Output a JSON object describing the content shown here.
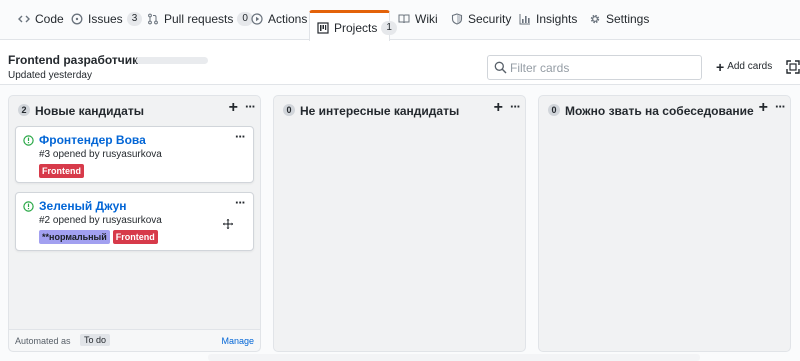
{
  "tabs": [
    {
      "label": "Code",
      "icon": "code-icon",
      "counter": null
    },
    {
      "label": "Issues",
      "icon": "issue-opened-icon",
      "counter": "3"
    },
    {
      "label": "Pull requests",
      "icon": "git-pull-request-icon",
      "counter": "0"
    },
    {
      "label": "Actions",
      "icon": "play-icon",
      "counter": null
    },
    {
      "label": "Projects",
      "icon": "project-icon",
      "counter": "1",
      "selected": true
    },
    {
      "label": "Wiki",
      "icon": "book-icon",
      "counter": null
    },
    {
      "label": "Security",
      "icon": "shield-icon",
      "counter": null
    },
    {
      "label": "Insights",
      "icon": "graph-icon",
      "counter": null
    },
    {
      "label": "Settings",
      "icon": "gear-icon",
      "counter": null
    }
  ],
  "project": {
    "title": "Frontend разработчики",
    "updated": "Updated yesterday"
  },
  "toolbar": {
    "filter_placeholder": "Filter cards",
    "filter_value": "",
    "add_cards_label": "Add cards"
  },
  "columns": [
    {
      "count": "2",
      "name": "Новые кандидаты",
      "footer": {
        "automated_as": "Automated as",
        "badge": "To do",
        "manage": "Manage"
      },
      "cards": [
        {
          "title": "Фронтендер Вова",
          "meta": "#3 opened by rusyasurkova",
          "labels": [
            {
              "text": "Frontend",
              "bg": "#d73a4a",
              "fg": "#ffffff"
            }
          ]
        },
        {
          "title": "Зеленый Джун",
          "meta": "#2 opened by rusyasurkova",
          "labels": [
            {
              "text": "**нормальный",
              "bg": "#a2a0f0",
              "fg": "#1b1f23"
            },
            {
              "text": "Frontend",
              "bg": "#d73a4a",
              "fg": "#ffffff"
            }
          ]
        }
      ]
    },
    {
      "count": "0",
      "name": "Не интересные кандидаты",
      "cards": []
    },
    {
      "count": "0",
      "name": "Можно звать на собеседование",
      "cards": []
    }
  ],
  "colors": {
    "accent_tab": "#e36209",
    "link": "#0366d6",
    "issue_open": "#28a745",
    "label_frontend": "#d73a4a",
    "label_normal": "#a2a0f0"
  }
}
